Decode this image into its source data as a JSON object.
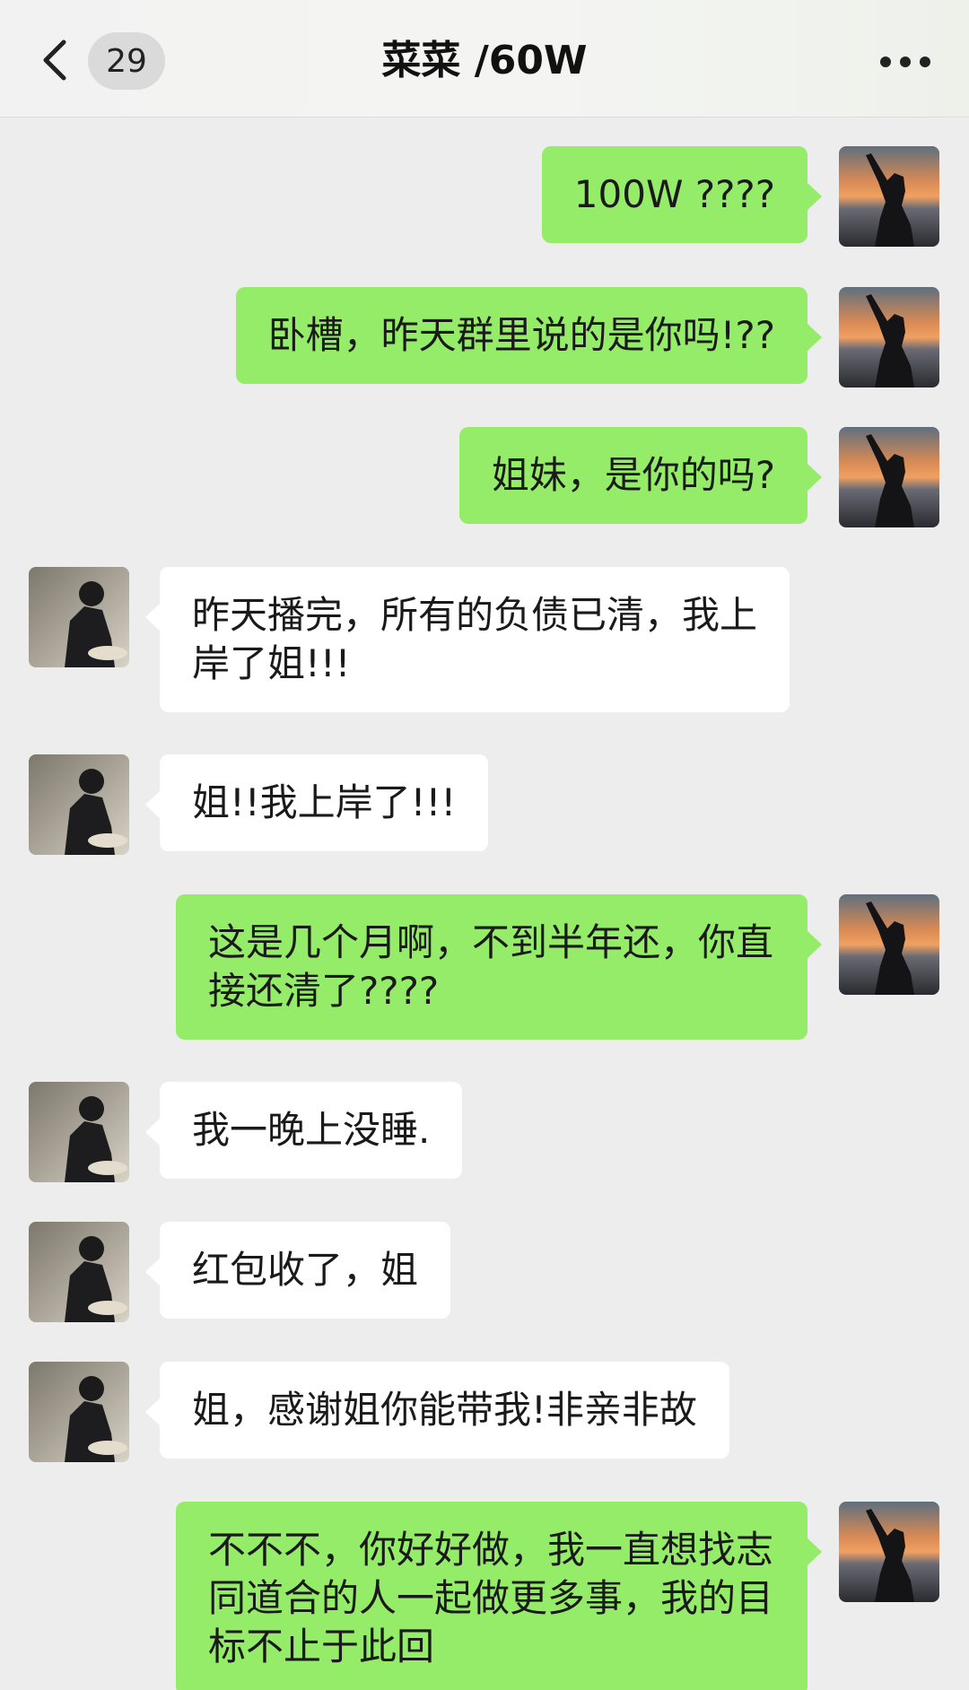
{
  "header": {
    "back_icon": "chevron-left-icon",
    "unread_count": "29",
    "title": "菜菜 /60W",
    "more_icon": "more-dots-icon"
  },
  "messages": [
    {
      "from": "me",
      "text": "100W ????"
    },
    {
      "from": "me",
      "text": "卧槽，昨天群里说的是你吗!??"
    },
    {
      "from": "me",
      "text": "姐妹，是你的吗?"
    },
    {
      "from": "them",
      "text": "昨天播完，所有的负债已清，我上岸了姐!!!"
    },
    {
      "from": "them",
      "text": "姐!!我上岸了!!!"
    },
    {
      "from": "me",
      "text": "这是几个月啊，不到半年还，你直接还清了????"
    },
    {
      "from": "them",
      "text": "我一晚上没睡."
    },
    {
      "from": "them",
      "text": "红包收了，姐"
    },
    {
      "from": "them",
      "text": "姐，感谢姐你能带我!非亲非故"
    },
    {
      "from": "me",
      "text": "不不不，你好好做，我一直想找志同道合的人一起做更多事，我的目标不止于此回"
    }
  ],
  "colors": {
    "background": "#ededed",
    "my_bubble": "#95ec69",
    "their_bubble": "#ffffff"
  }
}
